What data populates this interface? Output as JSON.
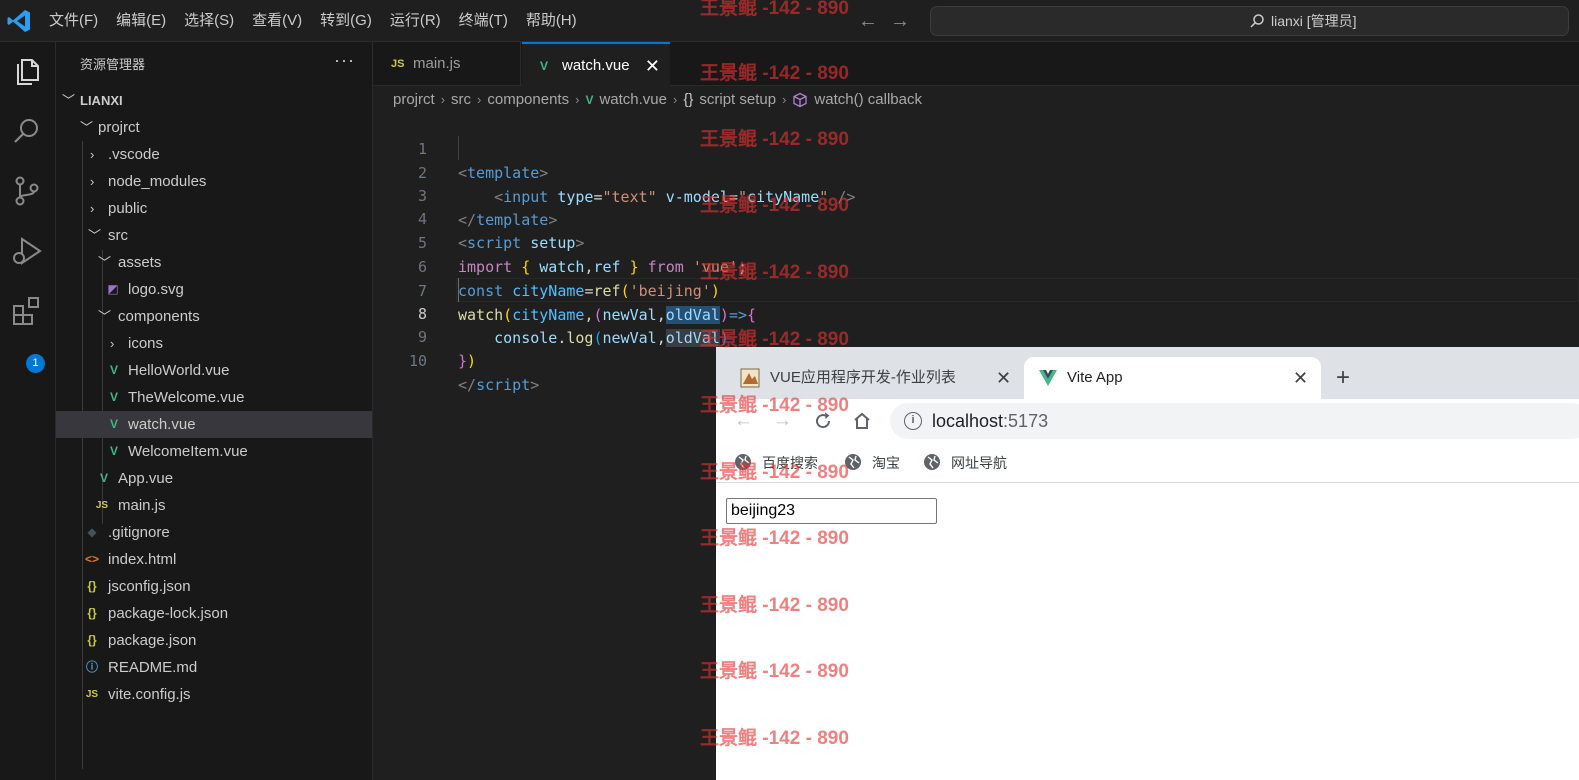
{
  "menu": [
    "文件(F)",
    "编辑(E)",
    "选择(S)",
    "查看(V)",
    "转到(G)",
    "运行(R)",
    "终端(T)",
    "帮助(H)"
  ],
  "command_center": {
    "text": "lianxi [管理员]"
  },
  "activity": {
    "extensions_badge": "1"
  },
  "explorer": {
    "title": "资源管理器",
    "more": "···",
    "root": "LIANXI",
    "items": [
      {
        "label": "projrct"
      },
      {
        "label": ".vscode"
      },
      {
        "label": "node_modules"
      },
      {
        "label": "public"
      },
      {
        "label": "src"
      },
      {
        "label": "assets"
      },
      {
        "label": "logo.svg"
      },
      {
        "label": "components"
      },
      {
        "label": "icons"
      },
      {
        "label": "HelloWorld.vue"
      },
      {
        "label": "TheWelcome.vue"
      },
      {
        "label": "watch.vue"
      },
      {
        "label": "WelcomeItem.vue"
      },
      {
        "label": "App.vue"
      },
      {
        "label": "main.js"
      },
      {
        "label": ".gitignore"
      },
      {
        "label": "index.html"
      },
      {
        "label": "jsconfig.json"
      },
      {
        "label": "package-lock.json"
      },
      {
        "label": "package.json"
      },
      {
        "label": "README.md"
      },
      {
        "label": "vite.config.js"
      }
    ]
  },
  "tabs": [
    {
      "label": "main.js",
      "icon": "JS"
    },
    {
      "label": "watch.vue",
      "close": "✕"
    }
  ],
  "breadcrumbs": [
    "projrct",
    "src",
    "components",
    "watch.vue",
    "script setup",
    "watch() callback"
  ],
  "editor": {
    "line_numbers": [
      "1",
      "2",
      "3",
      "4",
      "5",
      "6",
      "7",
      "8",
      "9",
      "10"
    ],
    "current_line": 8
  },
  "browser": {
    "tabs": [
      {
        "label": "VUE应用程序开发-作业列表"
      },
      {
        "label": "Vite App"
      }
    ],
    "url_host": "localhost",
    "url_port": ":5173",
    "bookmarks": [
      "百度搜索",
      "淘宝",
      "网址导航"
    ],
    "input_value": "beijing23"
  },
  "watermark": "王景鲲 -142 - 890",
  "colors": {
    "accent": "#0078d4",
    "vue_green": "#41b883",
    "js_yellow": "#cbcb41"
  }
}
